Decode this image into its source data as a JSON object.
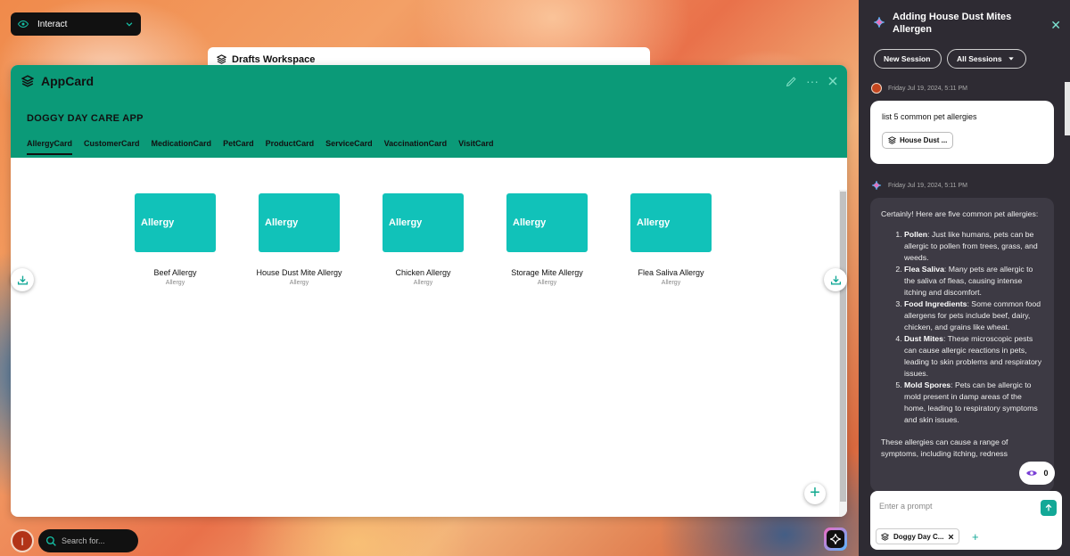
{
  "mode_selector": {
    "label": "Interact"
  },
  "drafts_tab": {
    "title": "Drafts Workspace"
  },
  "app_window": {
    "title": "AppCard",
    "app_name": "DOGGY DAY CARE APP",
    "tabs": [
      {
        "label": "AllergyCard",
        "active": true
      },
      {
        "label": "CustomerCard"
      },
      {
        "label": "MedicationCard"
      },
      {
        "label": "PetCard"
      },
      {
        "label": "ProductCard"
      },
      {
        "label": "ServiceCard"
      },
      {
        "label": "VaccinationCard"
      },
      {
        "label": "VisitCard"
      }
    ],
    "items": [
      {
        "thumb_label": "Allergy",
        "title": "Beef Allergy",
        "subtitle": "Allergy"
      },
      {
        "thumb_label": "Allergy",
        "title": "House Dust Mite Allergy",
        "subtitle": "Allergy"
      },
      {
        "thumb_label": "Allergy",
        "title": "Chicken Allergy",
        "subtitle": "Allergy"
      },
      {
        "thumb_label": "Allergy",
        "title": "Storage Mite Allergy",
        "subtitle": "Allergy"
      },
      {
        "thumb_label": "Allergy",
        "title": "Flea Saliva Allergy",
        "subtitle": "Allergy"
      }
    ],
    "add_symbol": "+"
  },
  "user": {
    "initial": "I"
  },
  "search": {
    "placeholder": "Search for..."
  },
  "chat": {
    "title": "Adding House Dust Mites Allergen",
    "new_session_label": "New Session",
    "all_sessions_label": "All Sessions",
    "user_message": {
      "timestamp": "Friday Jul 19, 2024, 5:11 PM",
      "text": "list 5 common pet allergies",
      "attachment": "House Dust ..."
    },
    "ai_message": {
      "timestamp": "Friday Jul 19, 2024, 5:11 PM",
      "intro": "Certainly! Here are five common pet allergies:",
      "items": [
        {
          "term": "Pollen",
          "text": ": Just like humans, pets can be allergic to pollen from trees, grass, and weeds."
        },
        {
          "term": "Flea Saliva",
          "text": ": Many pets are allergic to the saliva of fleas, causing intense itching and discomfort."
        },
        {
          "term": "Food Ingredients",
          "text": ": Some common food allergens for pets include beef, dairy, chicken, and grains like wheat."
        },
        {
          "term": "Dust Mites",
          "text": ": These microscopic pests can cause allergic reactions in pets, leading to skin problems and respiratory issues."
        },
        {
          "term": "Mold Spores",
          "text": ": Pets can be allergic to mold present in damp areas of the home, leading to respiratory symptoms and skin issues."
        }
      ],
      "outro": "These allergies can cause a range of symptoms, including itching, redness"
    },
    "reaction_count": "0",
    "prompt_placeholder": "Enter a prompt",
    "context_chip": "Doggy Day C...",
    "context_add": "+"
  },
  "colors": {
    "header": "#0b9a78",
    "thumb": "#11c2b9",
    "panel_bg": "#2e2b33",
    "accent": "#13a897"
  }
}
